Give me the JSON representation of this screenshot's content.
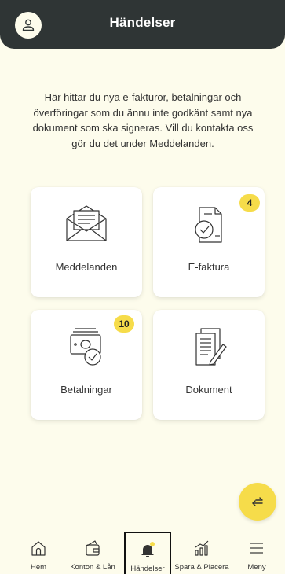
{
  "header": {
    "title": "Händelser"
  },
  "intro": {
    "text": "Här hittar du nya e-fakturor, betalningar och överföringar som du ännu inte godkänt samt nya dokument som ska signeras. Vill du kontakta oss gör du det under Meddelanden."
  },
  "cards": [
    {
      "label": "Meddelanden",
      "icon": "envelope-icon",
      "badge": ""
    },
    {
      "label": "E-faktura",
      "icon": "e-invoice-icon",
      "badge": "4"
    },
    {
      "label": "Betalningar",
      "icon": "payments-icon",
      "badge": "10"
    },
    {
      "label": "Dokument",
      "icon": "document-sign-icon",
      "badge": ""
    }
  ],
  "fab": {
    "icon": "transfer-arrows-icon"
  },
  "tabbar": {
    "items": [
      {
        "label": "Hem",
        "icon": "home-icon"
      },
      {
        "label": "Konton & Lån",
        "icon": "wallet-icon"
      },
      {
        "label": "Händelser",
        "icon": "bell-icon",
        "active": true
      },
      {
        "label": "Spara & Placera",
        "icon": "chart-icon"
      },
      {
        "label": "Meny",
        "icon": "menu-icon"
      }
    ]
  },
  "colors": {
    "background": "#fdfcec",
    "header": "#2f3535",
    "accent": "#f6dc4a",
    "card": "#ffffff"
  }
}
